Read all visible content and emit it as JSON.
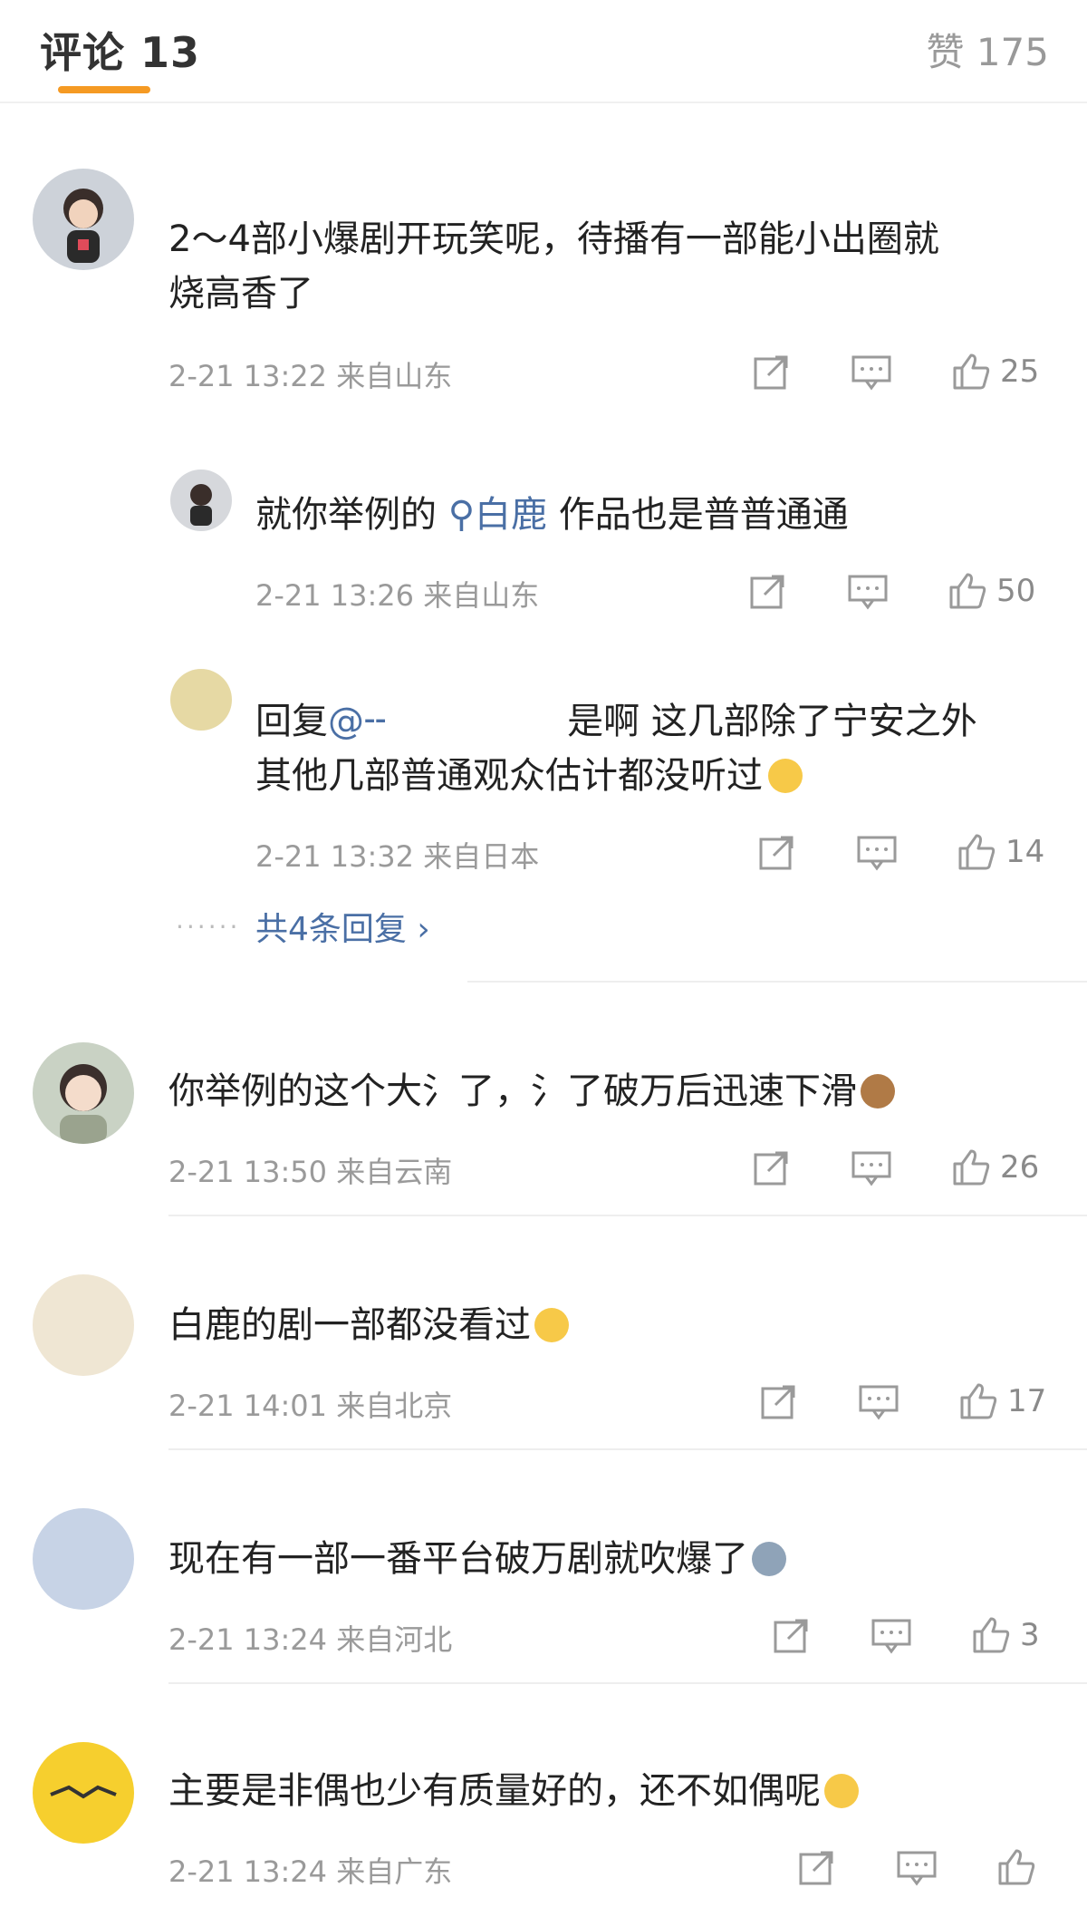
{
  "header": {
    "tab_comments": "评论 13",
    "tab_likes": "赞 175"
  },
  "comments": [
    {
      "text": "2～4部小爆剧开玩笑呢，待播有一部能小出圈就烧高香了",
      "line1": "2～4部小爆剧开玩笑呢，待播有一部能小出圈就",
      "line2": "烧高香了",
      "meta": "2-21 13:22  来自山东",
      "likes": "25"
    },
    {
      "reply": true,
      "text_prefix": "就你举例的 ",
      "link_text": "白鹿",
      "text_suffix": " 作品也是普普通通",
      "meta": "2-21 13:26  来自山东",
      "likes": "50"
    },
    {
      "reply": true,
      "line1_prefix": "回复",
      "line1_mention": "@╌",
      "line1_rest": "是啊 这几部除了宁安之外",
      "line2": "其他几部普通观众估计都没听过",
      "meta": "2-21 13:32  来自日本",
      "likes": "14",
      "more_replies": "共4条回复 ›"
    },
    {
      "text": "你举例的这个大氵了，氵了破万后迅速下滑",
      "meta": "2-21 13:50  来自云南",
      "likes": "26"
    },
    {
      "text": "白鹿的剧一部都没看过",
      "meta": "2-21 14:01  来自北京",
      "likes": "17"
    },
    {
      "text": "现在有一部一番平台破万剧就吹爆了",
      "meta": "2-21 13:24  来自河北",
      "likes": "3"
    },
    {
      "text": "主要是非偶也少有质量好的，还不如偶呢",
      "meta": "2-21 13:24  来自广东",
      "likes": ""
    }
  ],
  "colors": {
    "accent_underline": "#f59a23",
    "link": "#4a6fa5",
    "meta_text": "#9a9a9a"
  },
  "icons": {
    "share": "share-icon",
    "comment": "comment-icon",
    "like": "thumbs-up-icon"
  }
}
